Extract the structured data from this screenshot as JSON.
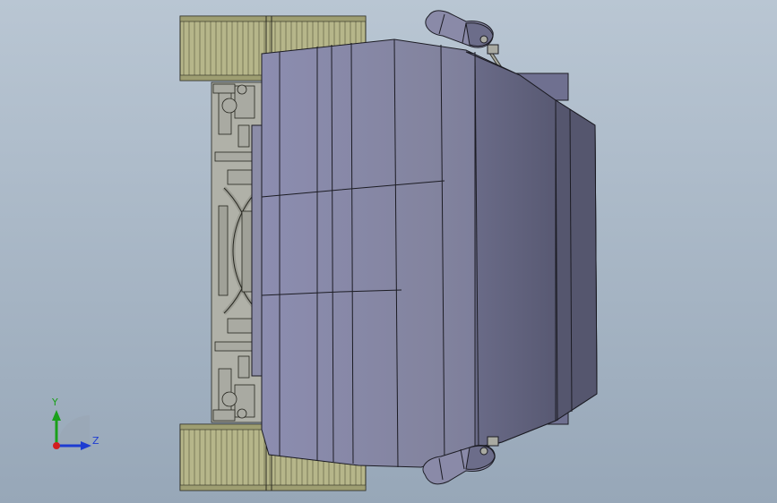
{
  "viewport": {
    "background_top": "#b9c6d3",
    "background_bottom": "#97a7b8"
  },
  "model": {
    "body_color": "#7e7f9e",
    "tire_color": "#b4b488",
    "frame_color": "#a7a8a0",
    "edge_color": "#1c1c24"
  },
  "triad": {
    "y_label": "Y",
    "z_label": "Z",
    "y_color": "#1aa01a",
    "z_color": "#1e3cd2",
    "x_color": "#d21e1e"
  }
}
